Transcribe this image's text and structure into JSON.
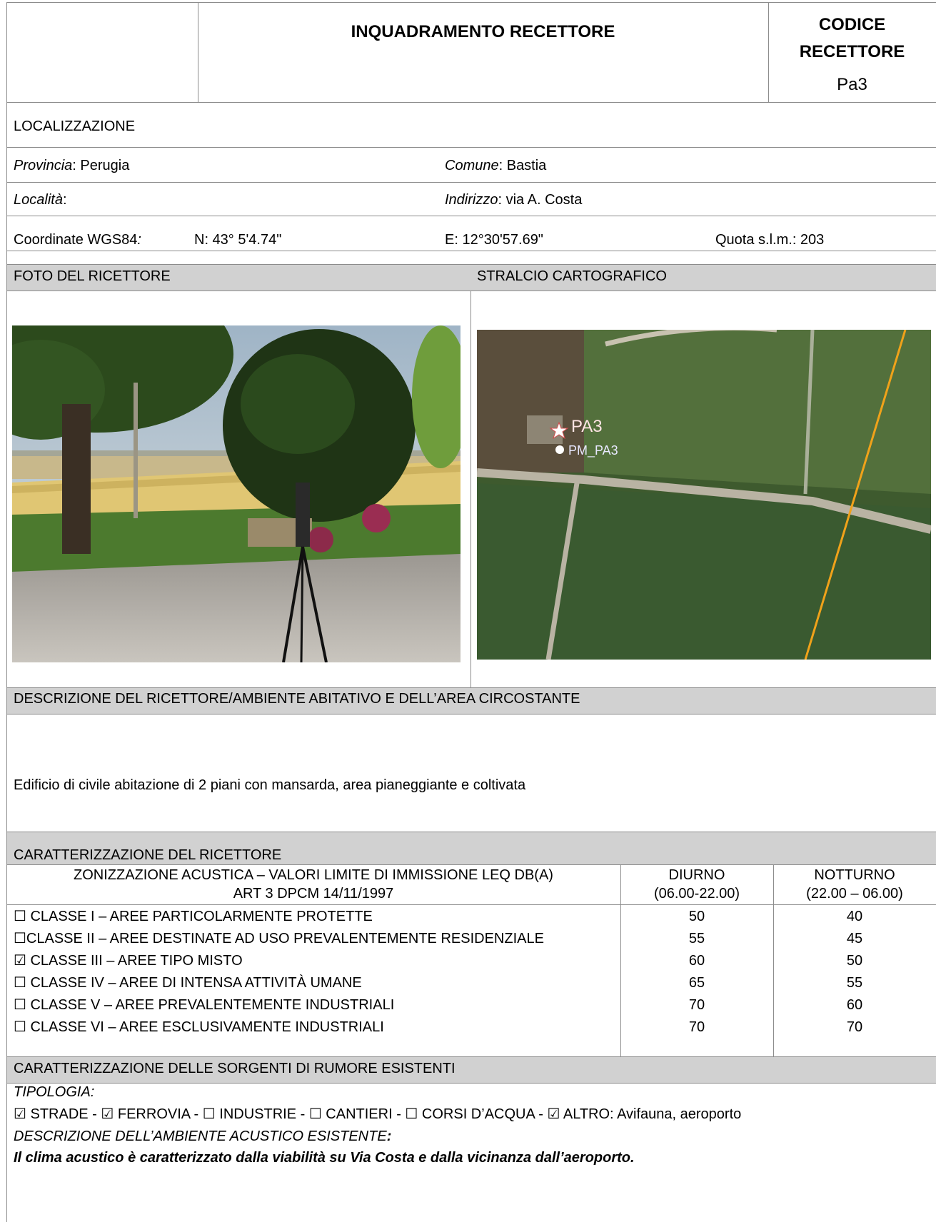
{
  "header": {
    "title": "INQUADRAMENTO RECETTORE",
    "code_label_line1": "CODICE",
    "code_label_line2": "RECETTORE",
    "code_value": "Pa3"
  },
  "localization": {
    "heading": "LOCALIZZAZIONE",
    "provincia_label": "Provincia",
    "provincia_value": ": Perugia",
    "comune_label": "Comune",
    "comune_value": ": Bastia",
    "localita_label": "Località",
    "localita_value": ":",
    "indirizzo_label": "Indirizzo",
    "indirizzo_value": ": via A. Costa",
    "coord_label": "Coordinate WGS84",
    "coord_colon": ":",
    "north": "N: 43° 5'4.74\"",
    "east": "E: 12°30'57.69\"",
    "quota": "Quota s.l.m.: 203"
  },
  "photo_section": {
    "photo_heading": "FOTO DEL RICETTORE",
    "map_heading": "STRALCIO CARTOGRAFICO",
    "map_marker_receiver": "PA3",
    "map_marker_point": "PM_PA3"
  },
  "description": {
    "heading": "DESCRIZIONE DEL RICETTORE/AMBIENTE ABITATIVO E DELL’AREA CIRCOSTANTE",
    "text": "Edificio di civile abitazione di 2 piani con mansarda, area pianeggiante e coltivata"
  },
  "characterization": {
    "heading": "CARATTERIZZAZIONE DEL RICETTORE",
    "col_zoning_line1": "ZONIZZAZIONE ACUSTICA – VALORI LIMITE DI IMMISSIONE LEQ DB(A)",
    "col_zoning_line2": "ART 3 DPCM 14/11/1997",
    "col_day_line1": "DIURNO",
    "col_day_line2": "(06.00-22.00)",
    "col_night_line1": "NOTTURNO",
    "col_night_line2": "(22.00 – 06.00)",
    "rows": [
      {
        "label": "☐ CLASSE I – AREE PARTICOLARMENTE PROTETTE",
        "day": "50",
        "night": "40"
      },
      {
        "label": "☐CLASSE II – AREE DESTINATE AD USO PREVALENTEMENTE RESIDENZIALE",
        "day": "55",
        "night": "45"
      },
      {
        "label": "☑  CLASSE III – AREE TIPO MISTO",
        "day": "60",
        "night": "50"
      },
      {
        "label": "☐ CLASSE IV – AREE DI INTENSA ATTIVITÀ UMANE",
        "day": "65",
        "night": "55"
      },
      {
        "label": "☐ CLASSE V – AREE PREVALENTEMENTE INDUSTRIALI",
        "day": "70",
        "night": "60"
      },
      {
        "label": "☐ CLASSE VI – AREE ESCLUSIVAMENTE INDUSTRIALI",
        "day": "70",
        "night": "70"
      }
    ]
  },
  "sources": {
    "heading": "CARATTERIZZAZIONE DELLE SORGENTI DI RUMORE ESISTENTI",
    "tipologia_label": "TIPOLOGIA:",
    "tipologia_values": "☑ STRADE - ☑ FERROVIA - ☐ INDUSTRIE - ☐ CANTIERI - ☐ CORSI D’ACQUA - ☑ ALTRO: Avifauna, aeroporto",
    "ambient_label": "DESCRIZIONE DELL’AMBIENTE ACUSTICO ESISTENTE",
    "ambient_colon": ":",
    "ambient_text": "Il clima acustico è caratterizzato dalla viabilità su Via Costa e dalla vicinanza dall’aeroporto."
  }
}
